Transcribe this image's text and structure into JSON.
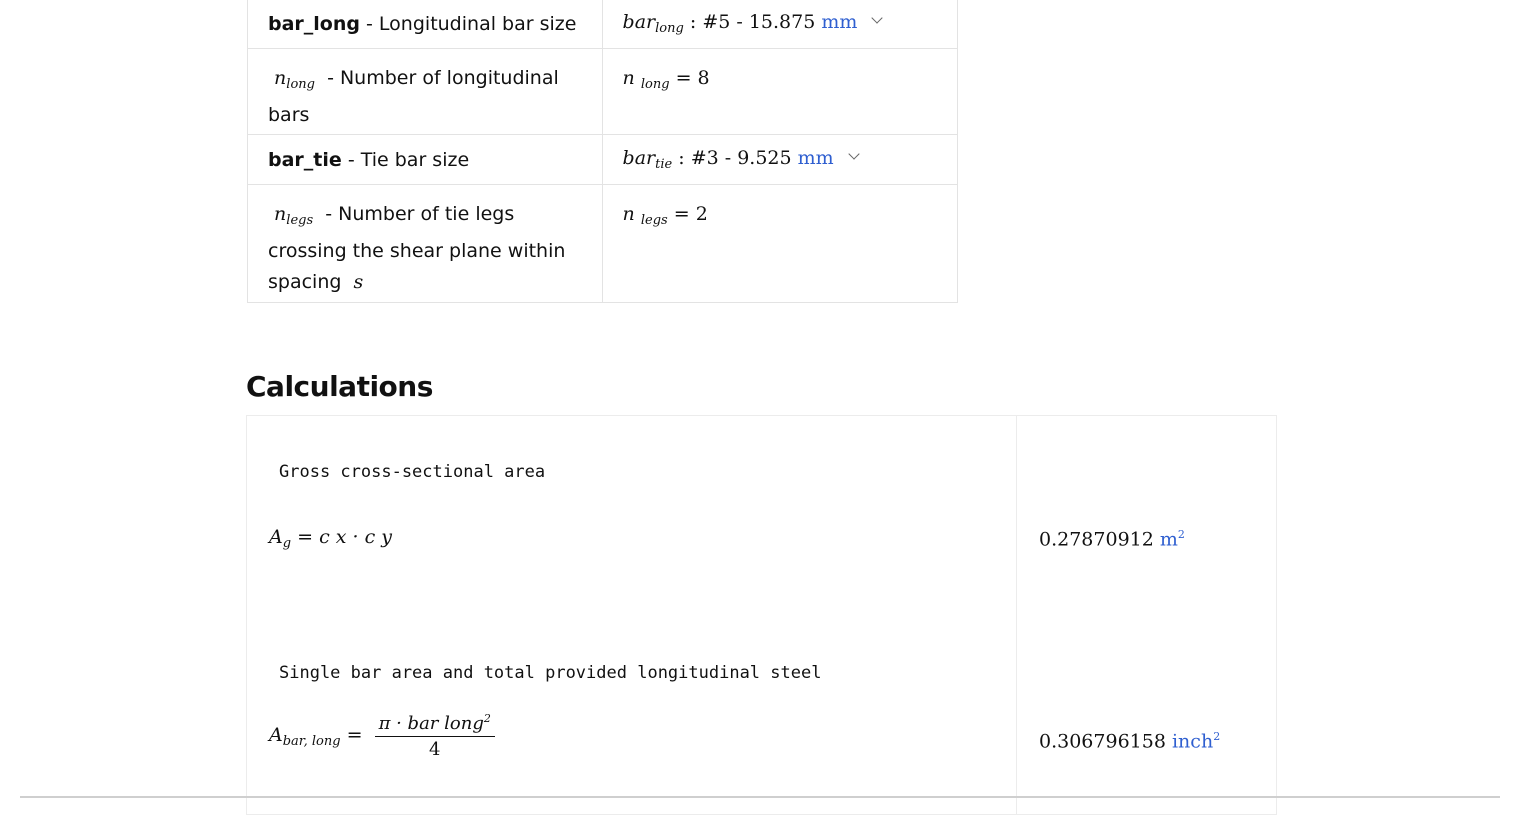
{
  "inputs": {
    "bar_long": {
      "label_bold": "bar_long",
      "label_rest": " - Longitudinal bar size",
      "sym": "bar",
      "sub": "long",
      "value": "#5 - 15.875",
      "unit": "mm"
    },
    "n_long": {
      "sym": "n",
      "sub": "long",
      "label_rest": " - Number of longitudinal bars",
      "value": "8"
    },
    "bar_tie": {
      "label_bold": "bar_tie",
      "label_rest": " - Tie bar size",
      "sym": "bar",
      "sub": "tie",
      "value": "#3 - 9.525",
      "unit": "mm"
    },
    "n_legs": {
      "sym": "n",
      "sub": "legs",
      "label_rest": " - Number of tie legs crossing the shear plane within spacing ",
      "spacing_sym": "s",
      "value": "2"
    }
  },
  "calculations": {
    "title": "Calculations",
    "items": [
      {
        "comment": "Gross cross-sectional area",
        "lhs_sym": "A",
        "lhs_sub": "g",
        "rhs": "c x · c y",
        "result": "0.27870912",
        "unit": "m",
        "unit_exp": "2"
      },
      {
        "comment": "Single bar area and total provided longitudinal steel",
        "lhs_sym": "A",
        "lhs_sub": "bar, long",
        "num": "π · bar long",
        "num_exp": "2",
        "den": "4",
        "result": "0.306796158",
        "unit": "inch",
        "unit_exp": "2"
      }
    ]
  }
}
